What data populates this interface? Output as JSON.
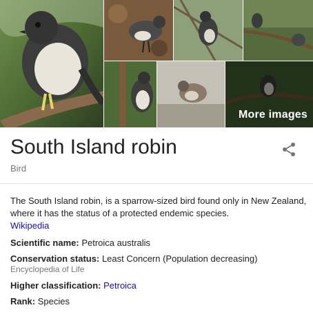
{
  "gallery": {
    "more_images_label": "More images",
    "images": [
      {
        "name": "robin-photo-main",
        "subject": "bird perched on branch"
      },
      {
        "name": "robin-photo-2",
        "subject": "bird on ground"
      },
      {
        "name": "robin-photo-3",
        "subject": "bird among branches"
      },
      {
        "name": "robin-photo-4",
        "subject": "bird in forest"
      },
      {
        "name": "robin-photo-5",
        "subject": "bird on trunk"
      },
      {
        "name": "robin-photo-6",
        "subject": "bird on ground"
      },
      {
        "name": "robin-photo-7",
        "subject": "bird on branch"
      }
    ]
  },
  "entity": {
    "title": "South Island robin",
    "type": "Bird",
    "share_icon": "share-icon"
  },
  "description": {
    "text": "The South Island robin, is a sparrow-sized bird found only in New Zealand, where it has the status of a protected endemic species.",
    "source_link": "Wikipedia"
  },
  "facts": {
    "scientific_name": {
      "label": "Scientific name:",
      "value": "Petroica australis"
    },
    "conservation_status": {
      "label": "Conservation status:",
      "value": "Least Concern (Population decreasing)",
      "source": "Encyclopedia of Life"
    },
    "higher_classification": {
      "label": "Higher classification:",
      "value": "Petroica"
    },
    "rank": {
      "label": "Rank:",
      "value": "Species"
    }
  },
  "colors": {
    "link": "#1a0dab",
    "muted_text": "#777777",
    "text": "#222222"
  }
}
